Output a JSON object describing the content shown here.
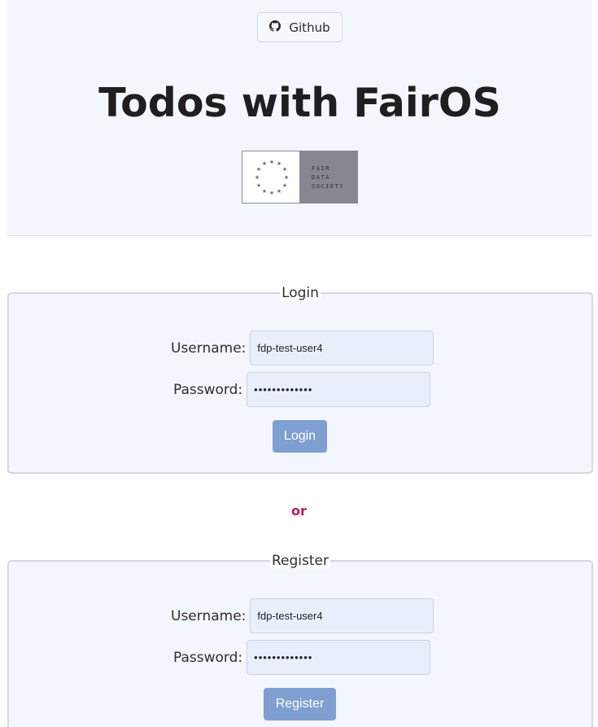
{
  "header": {
    "github_label": "Github",
    "title": "Todos with FairOS",
    "logo_lines": [
      "FAIR",
      "DATA",
      "SOCIETY"
    ]
  },
  "login": {
    "legend": "Login",
    "username_label": "Username:",
    "username_value": "fdp-test-user4",
    "password_label": "Password:",
    "password_value": "•••••••••••••",
    "button_label": "Login"
  },
  "separator": "or",
  "register": {
    "legend": "Register",
    "username_label": "Username:",
    "username_value": "fdp-test-user4",
    "password_label": "Password:",
    "password_value": "•••••••••••••",
    "button_label": "Register"
  },
  "colors": {
    "accent_button": "#7f9fd1",
    "or_text": "#c2185b",
    "panel_bg": "#f4f6fd"
  }
}
